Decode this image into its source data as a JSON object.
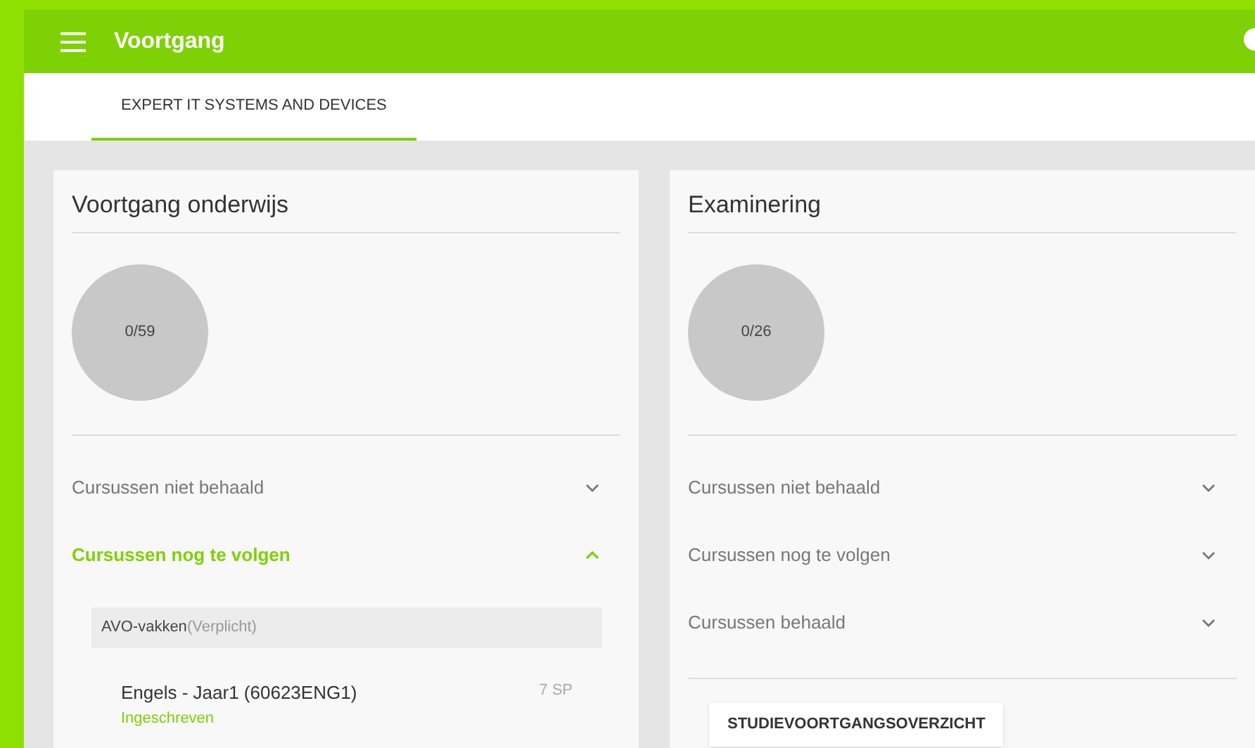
{
  "app_bar": {
    "title": "Voortgang"
  },
  "tabs": [
    {
      "label": "EXPERT IT SYSTEMS AND DEVICES",
      "selected": true
    }
  ],
  "cards": [
    {
      "title": "Voortgang onderwijs",
      "progress": "0/59",
      "sections": [
        {
          "label": "Cursussen niet behaald",
          "expanded": false
        },
        {
          "label": "Cursussen nog te volgen",
          "expanded": true,
          "groups": [
            {
              "name": "AVO-vakken",
              "note": "(Verplicht)",
              "courses": [
                {
                  "name": "Engels - Jaar1 (60623ENG1)",
                  "credits": "7 SP",
                  "status": "Ingeschreven"
                }
              ]
            }
          ]
        }
      ]
    },
    {
      "title": "Examinering",
      "progress": "0/26",
      "sections": [
        {
          "label": "Cursussen niet behaald",
          "expanded": false
        },
        {
          "label": "Cursussen nog te volgen",
          "expanded": false
        },
        {
          "label": "Cursussen behaald",
          "expanded": false
        }
      ],
      "button": "STUDIEVOORTGANGSOVERZICHT"
    }
  ]
}
